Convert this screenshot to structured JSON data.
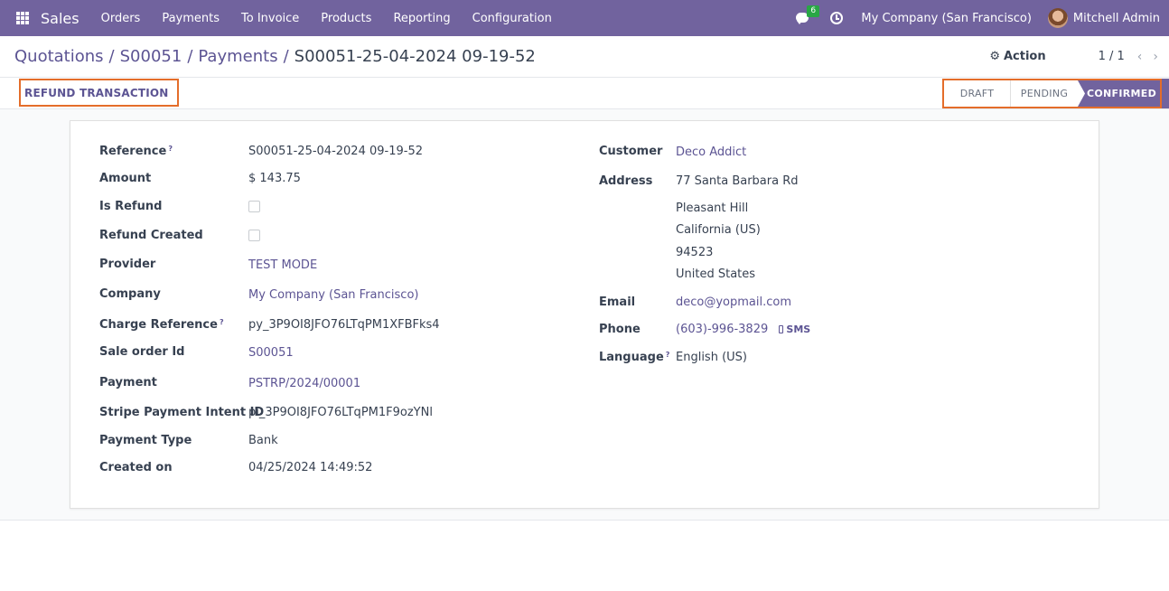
{
  "navbar": {
    "brand": "Sales",
    "menu": [
      "Orders",
      "Payments",
      "To Invoice",
      "Products",
      "Reporting",
      "Configuration"
    ],
    "chat_count": "6",
    "company": "My Company (San Francisco)",
    "user": "Mitchell Admin"
  },
  "control_panel": {
    "breadcrumbs": [
      "Quotations",
      "S00051",
      "Payments"
    ],
    "current": "S00051-25-04-2024 09-19-52",
    "action_label": "Action",
    "pager": "1 / 1"
  },
  "statusbar": {
    "refund_button": "REFUND TRANSACTION",
    "stages": [
      "DRAFT",
      "PENDING",
      "CONFIRMED"
    ],
    "active_stage": "CONFIRMED"
  },
  "form": {
    "left": [
      {
        "label": "Reference",
        "value": "S00051-25-04-2024 09-19-52",
        "help": true
      },
      {
        "label": "Amount",
        "value": "$ 143.75"
      },
      {
        "label": "Is Refund",
        "checkbox": false
      },
      {
        "label": "Refund Created",
        "checkbox": false
      },
      {
        "label": "Provider",
        "value": "TEST MODE",
        "link": true
      },
      {
        "label": "Company",
        "value": "My Company (San Francisco)",
        "link": true
      },
      {
        "label": "Charge Reference",
        "value": "py_3P9OI8JFO76LTqPM1XFBFks4",
        "help": true
      },
      {
        "label": "Sale order Id",
        "value": "S00051",
        "link": true
      },
      {
        "label": "Payment",
        "value": "PSTRP/2024/00001",
        "link": true
      },
      {
        "label": "Stripe Payment Intent ID",
        "value": "pi_3P9OI8JFO76LTqPM1F9ozYNl"
      },
      {
        "label": "Payment Type",
        "value": "Bank"
      },
      {
        "label": "Created on",
        "value": "04/25/2024 14:49:52"
      }
    ],
    "right": {
      "customer_label": "Customer",
      "customer": "Deco Addict",
      "address_label": "Address",
      "address_lines": [
        "77 Santa Barbara Rd",
        "Pleasant Hill",
        "California (US)",
        "94523",
        "United States"
      ],
      "email_label": "Email",
      "email": "deco@yopmail.com",
      "phone_label": "Phone",
      "phone": "(603)-996-3829",
      "sms_label": "SMS",
      "language_label": "Language",
      "language": "English (US)"
    }
  },
  "help_symbol": "?",
  "colors": {
    "brand": "#71639e",
    "link": "#5c5493",
    "highlight": "#e46d2a",
    "chat_badge": "#28a745"
  }
}
